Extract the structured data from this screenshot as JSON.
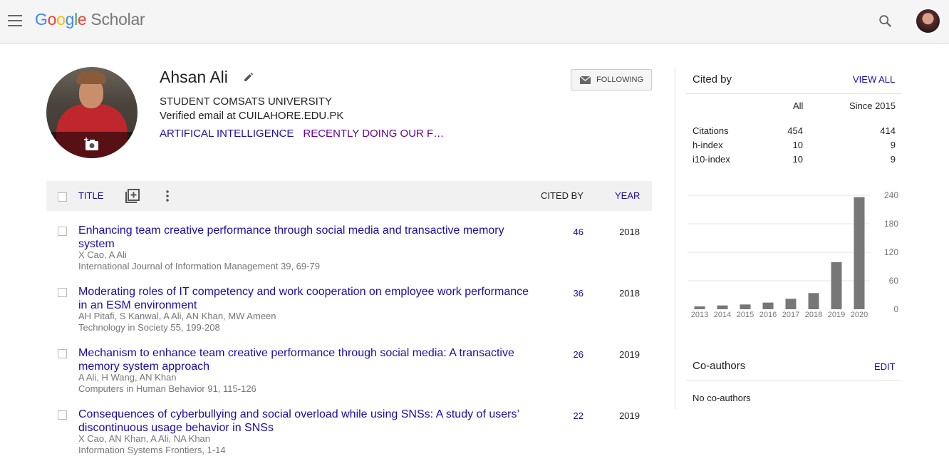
{
  "header": {
    "logo_letters": [
      "G",
      "o",
      "o",
      "g",
      "l",
      "e"
    ],
    "logo_suffix": "Scholar"
  },
  "profile": {
    "name": "Ahsan Ali",
    "affiliation": "STUDENT COMSATS UNIVERSITY",
    "email": "Verified email at CUILAHORE.EDU.PK",
    "interests": [
      "ARTIFICAL INTELLIGENCE",
      "RECENTLY DOING OUR F…"
    ],
    "follow_label": "FOLLOWING"
  },
  "table": {
    "title_header": "TITLE",
    "cited_by_header": "CITED BY",
    "year_header": "YEAR",
    "rows": [
      {
        "title": "Enhancing team creative performance through social media and transactive memory system",
        "authors": "X Cao, A Ali",
        "venue": "International Journal of Information Management 39, 69-79",
        "cited_by": "46",
        "year": "2018"
      },
      {
        "title": "Moderating roles of IT competency and work cooperation on employee work performance in an ESM environment",
        "authors": "AH Pitafi, S Kanwal, A Ali, AN Khan, MW Ameen",
        "venue": "Technology in Society 55, 199-208",
        "cited_by": "36",
        "year": "2018"
      },
      {
        "title": "Mechanism to enhance team creative performance through social media: A transactive memory system approach",
        "authors": "A Ali, H Wang, AN Khan",
        "venue": "Computers in Human Behavior 91, 115-126",
        "cited_by": "26",
        "year": "2019"
      },
      {
        "title": "Consequences of cyberbullying and social overload while using SNSs: A study of users’ discontinuous usage behavior in SNSs",
        "authors": "X Cao, AN Khan, A Ali, NA Khan",
        "venue": "Information Systems Frontiers, 1-14",
        "cited_by": "22",
        "year": "2019"
      }
    ]
  },
  "cited_by": {
    "heading": "Cited by",
    "view_all": "VIEW ALL",
    "col_all": "All",
    "col_since": "Since 2015",
    "metrics": [
      {
        "label": "Citations",
        "all": "454",
        "since": "414"
      },
      {
        "label": "h-index",
        "all": "10",
        "since": "9"
      },
      {
        "label": "i10-index",
        "all": "10",
        "since": "9"
      }
    ]
  },
  "chart_data": {
    "type": "bar",
    "categories": [
      "2013",
      "2014",
      "2015",
      "2016",
      "2017",
      "2018",
      "2019",
      "2020"
    ],
    "values": [
      6,
      8,
      10,
      14,
      22,
      34,
      99,
      236
    ],
    "y_ticks": [
      "0",
      "60",
      "120",
      "180",
      "240"
    ],
    "ylim": [
      0,
      240
    ],
    "grid": true,
    "bar_color": "#777777"
  },
  "coauthors": {
    "heading": "Co-authors",
    "edit": "EDIT",
    "empty_text": "No co-authors"
  }
}
